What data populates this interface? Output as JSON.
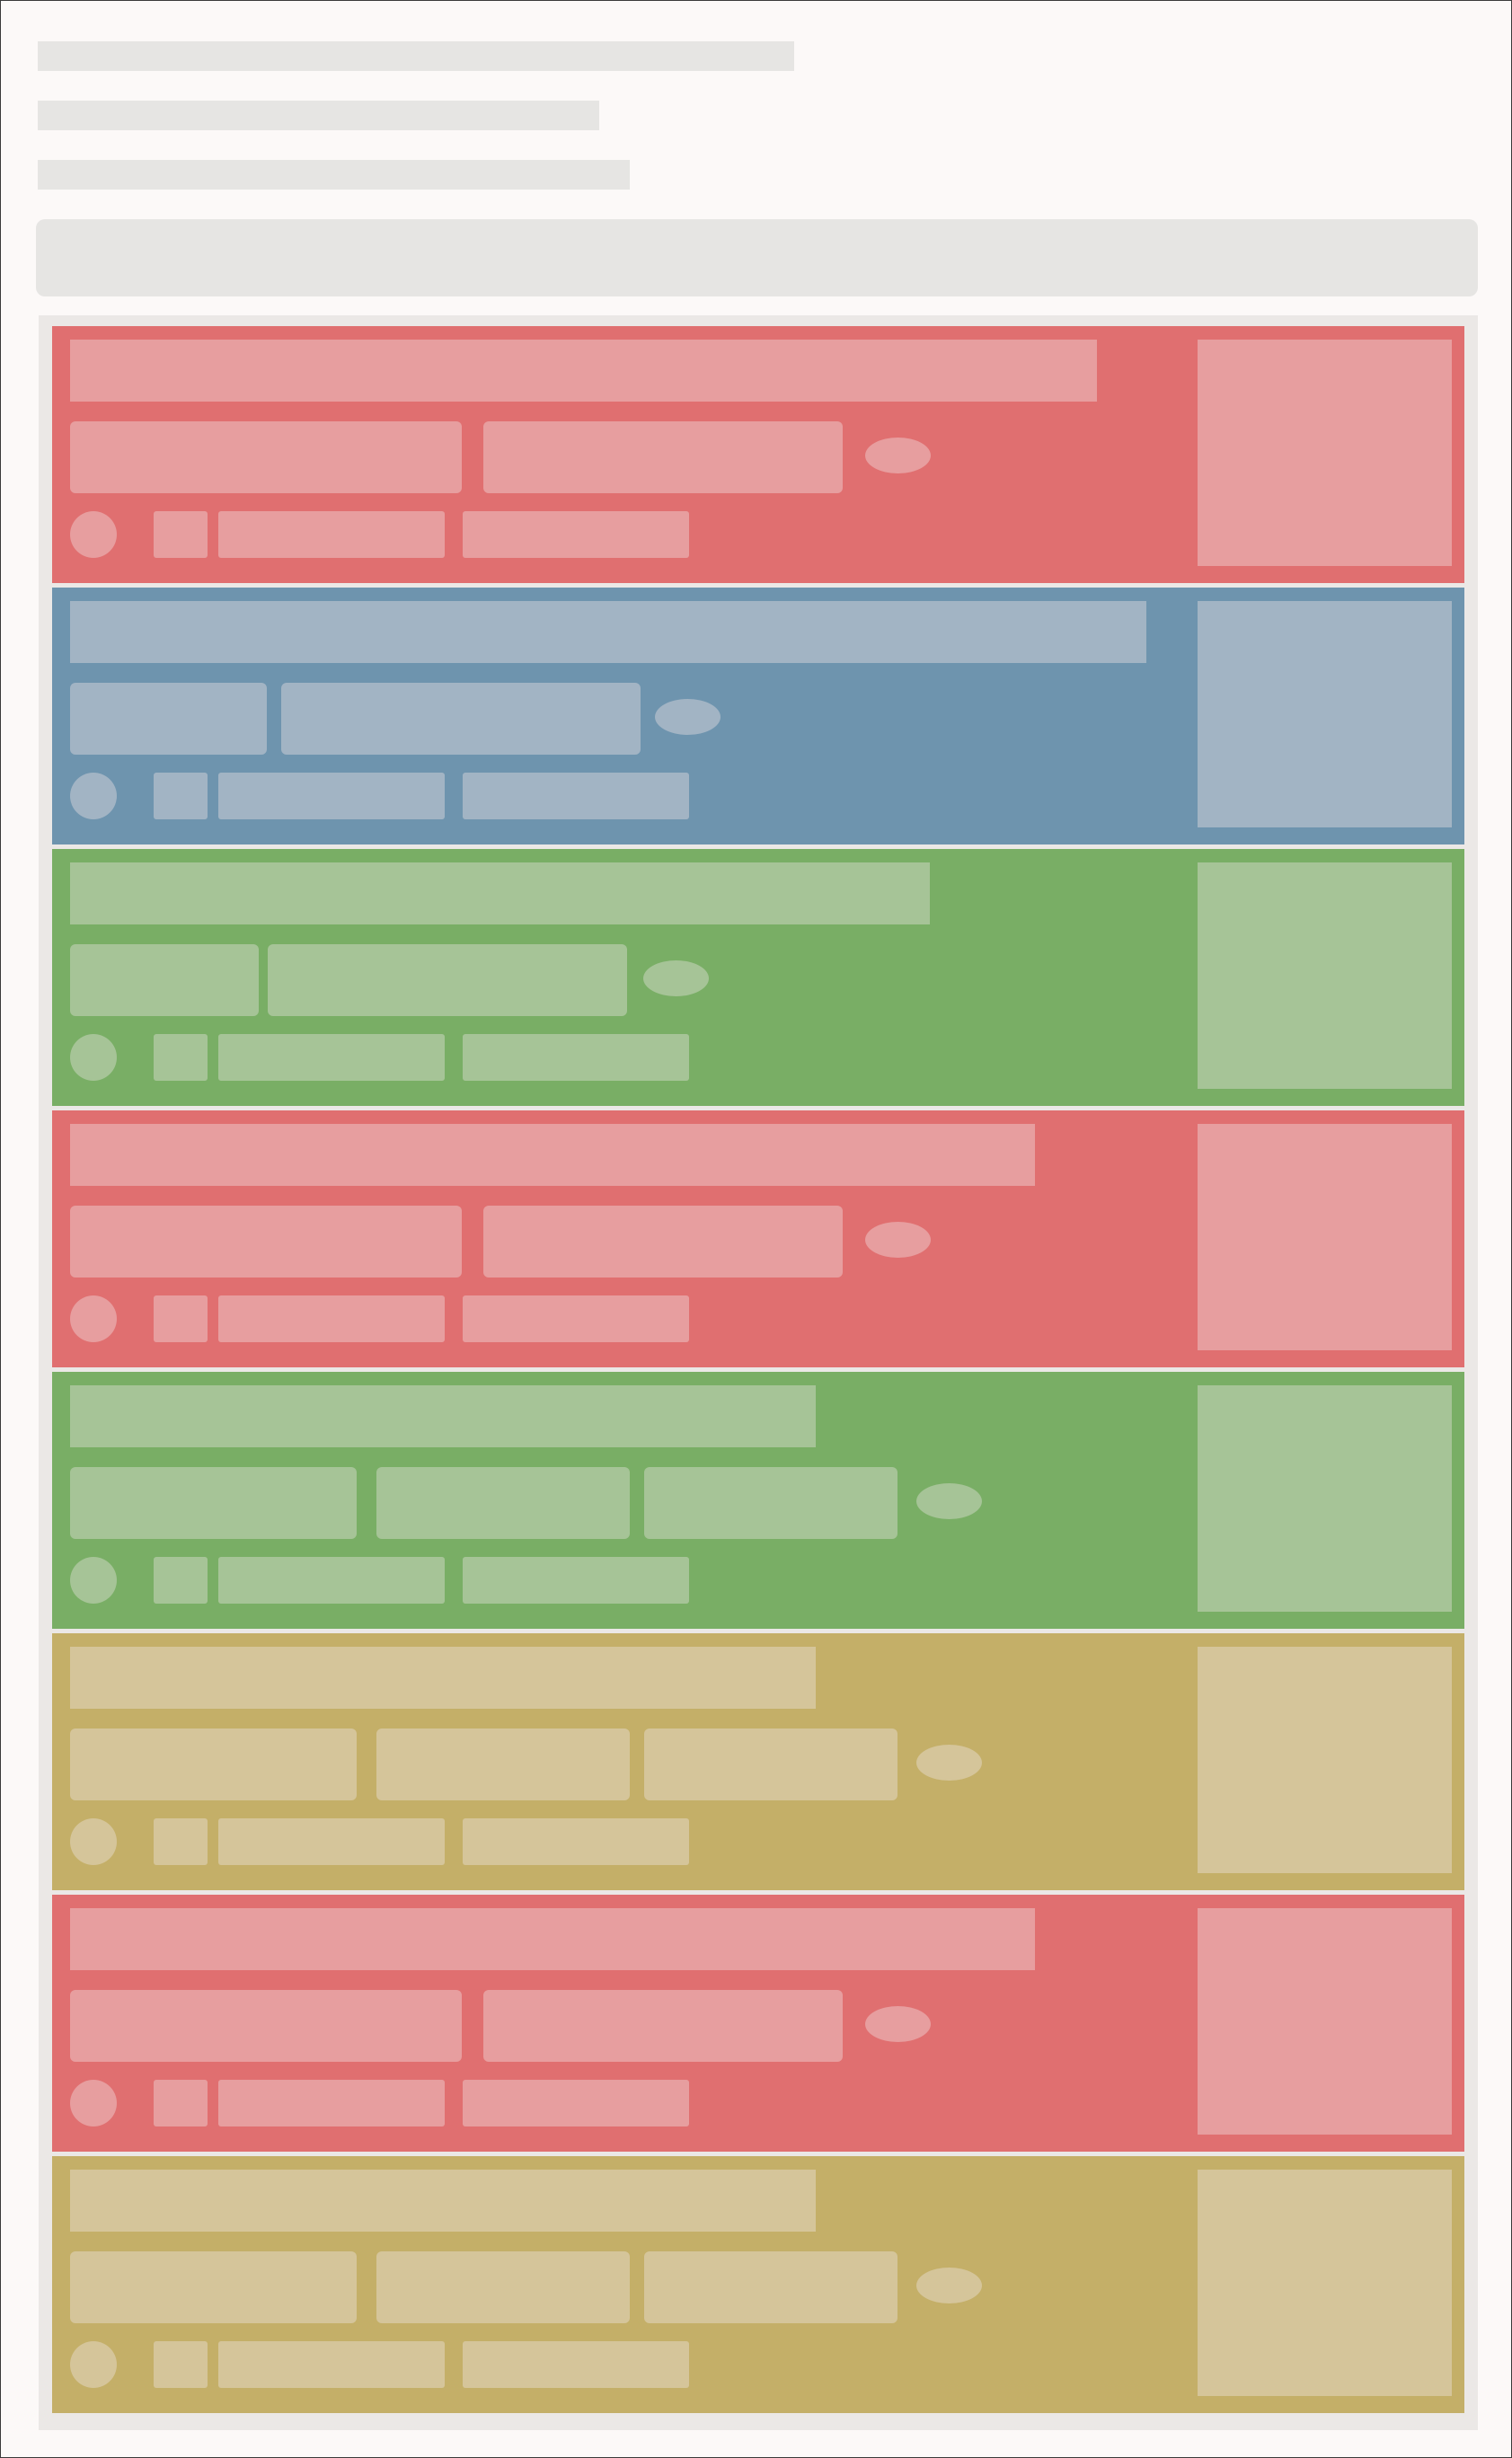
{
  "theme": {
    "page_background": "#fcf9f8",
    "skeleton_gray": "#e6e5e3",
    "list_background": "#ebe8e6",
    "palette": {
      "red": {
        "base": "#e06f70",
        "light": "#e79e9f"
      },
      "blue": {
        "base": "#6e94ae",
        "light": "#a2b4c4"
      },
      "green": {
        "base": "#79ae65",
        "light": "#a6c497"
      },
      "yellow": {
        "base": "#c4af68",
        "light": "#d5c59a"
      }
    }
  },
  "header_placeholders": [
    "text-line",
    "text-line",
    "text-line",
    "search-bar"
  ],
  "cards": [
    {
      "color": "red",
      "chip_count": 2
    },
    {
      "color": "blue",
      "chip_count": 2
    },
    {
      "color": "green",
      "chip_count": 2
    },
    {
      "color": "red",
      "chip_count": 2
    },
    {
      "color": "green",
      "chip_count": 3
    },
    {
      "color": "yellow",
      "chip_count": 3
    },
    {
      "color": "red",
      "chip_count": 2
    },
    {
      "color": "yellow",
      "chip_count": 3
    }
  ]
}
